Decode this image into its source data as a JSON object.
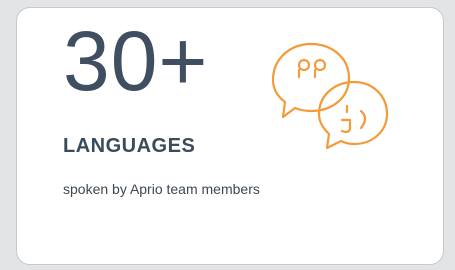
{
  "card": {
    "number": "30+",
    "title": "LANGUAGES",
    "description": "spoken by Aprio team members",
    "icon": "speech-bubbles-icon",
    "accent_color": "#f39a3a",
    "text_color": "#3f4f61"
  }
}
